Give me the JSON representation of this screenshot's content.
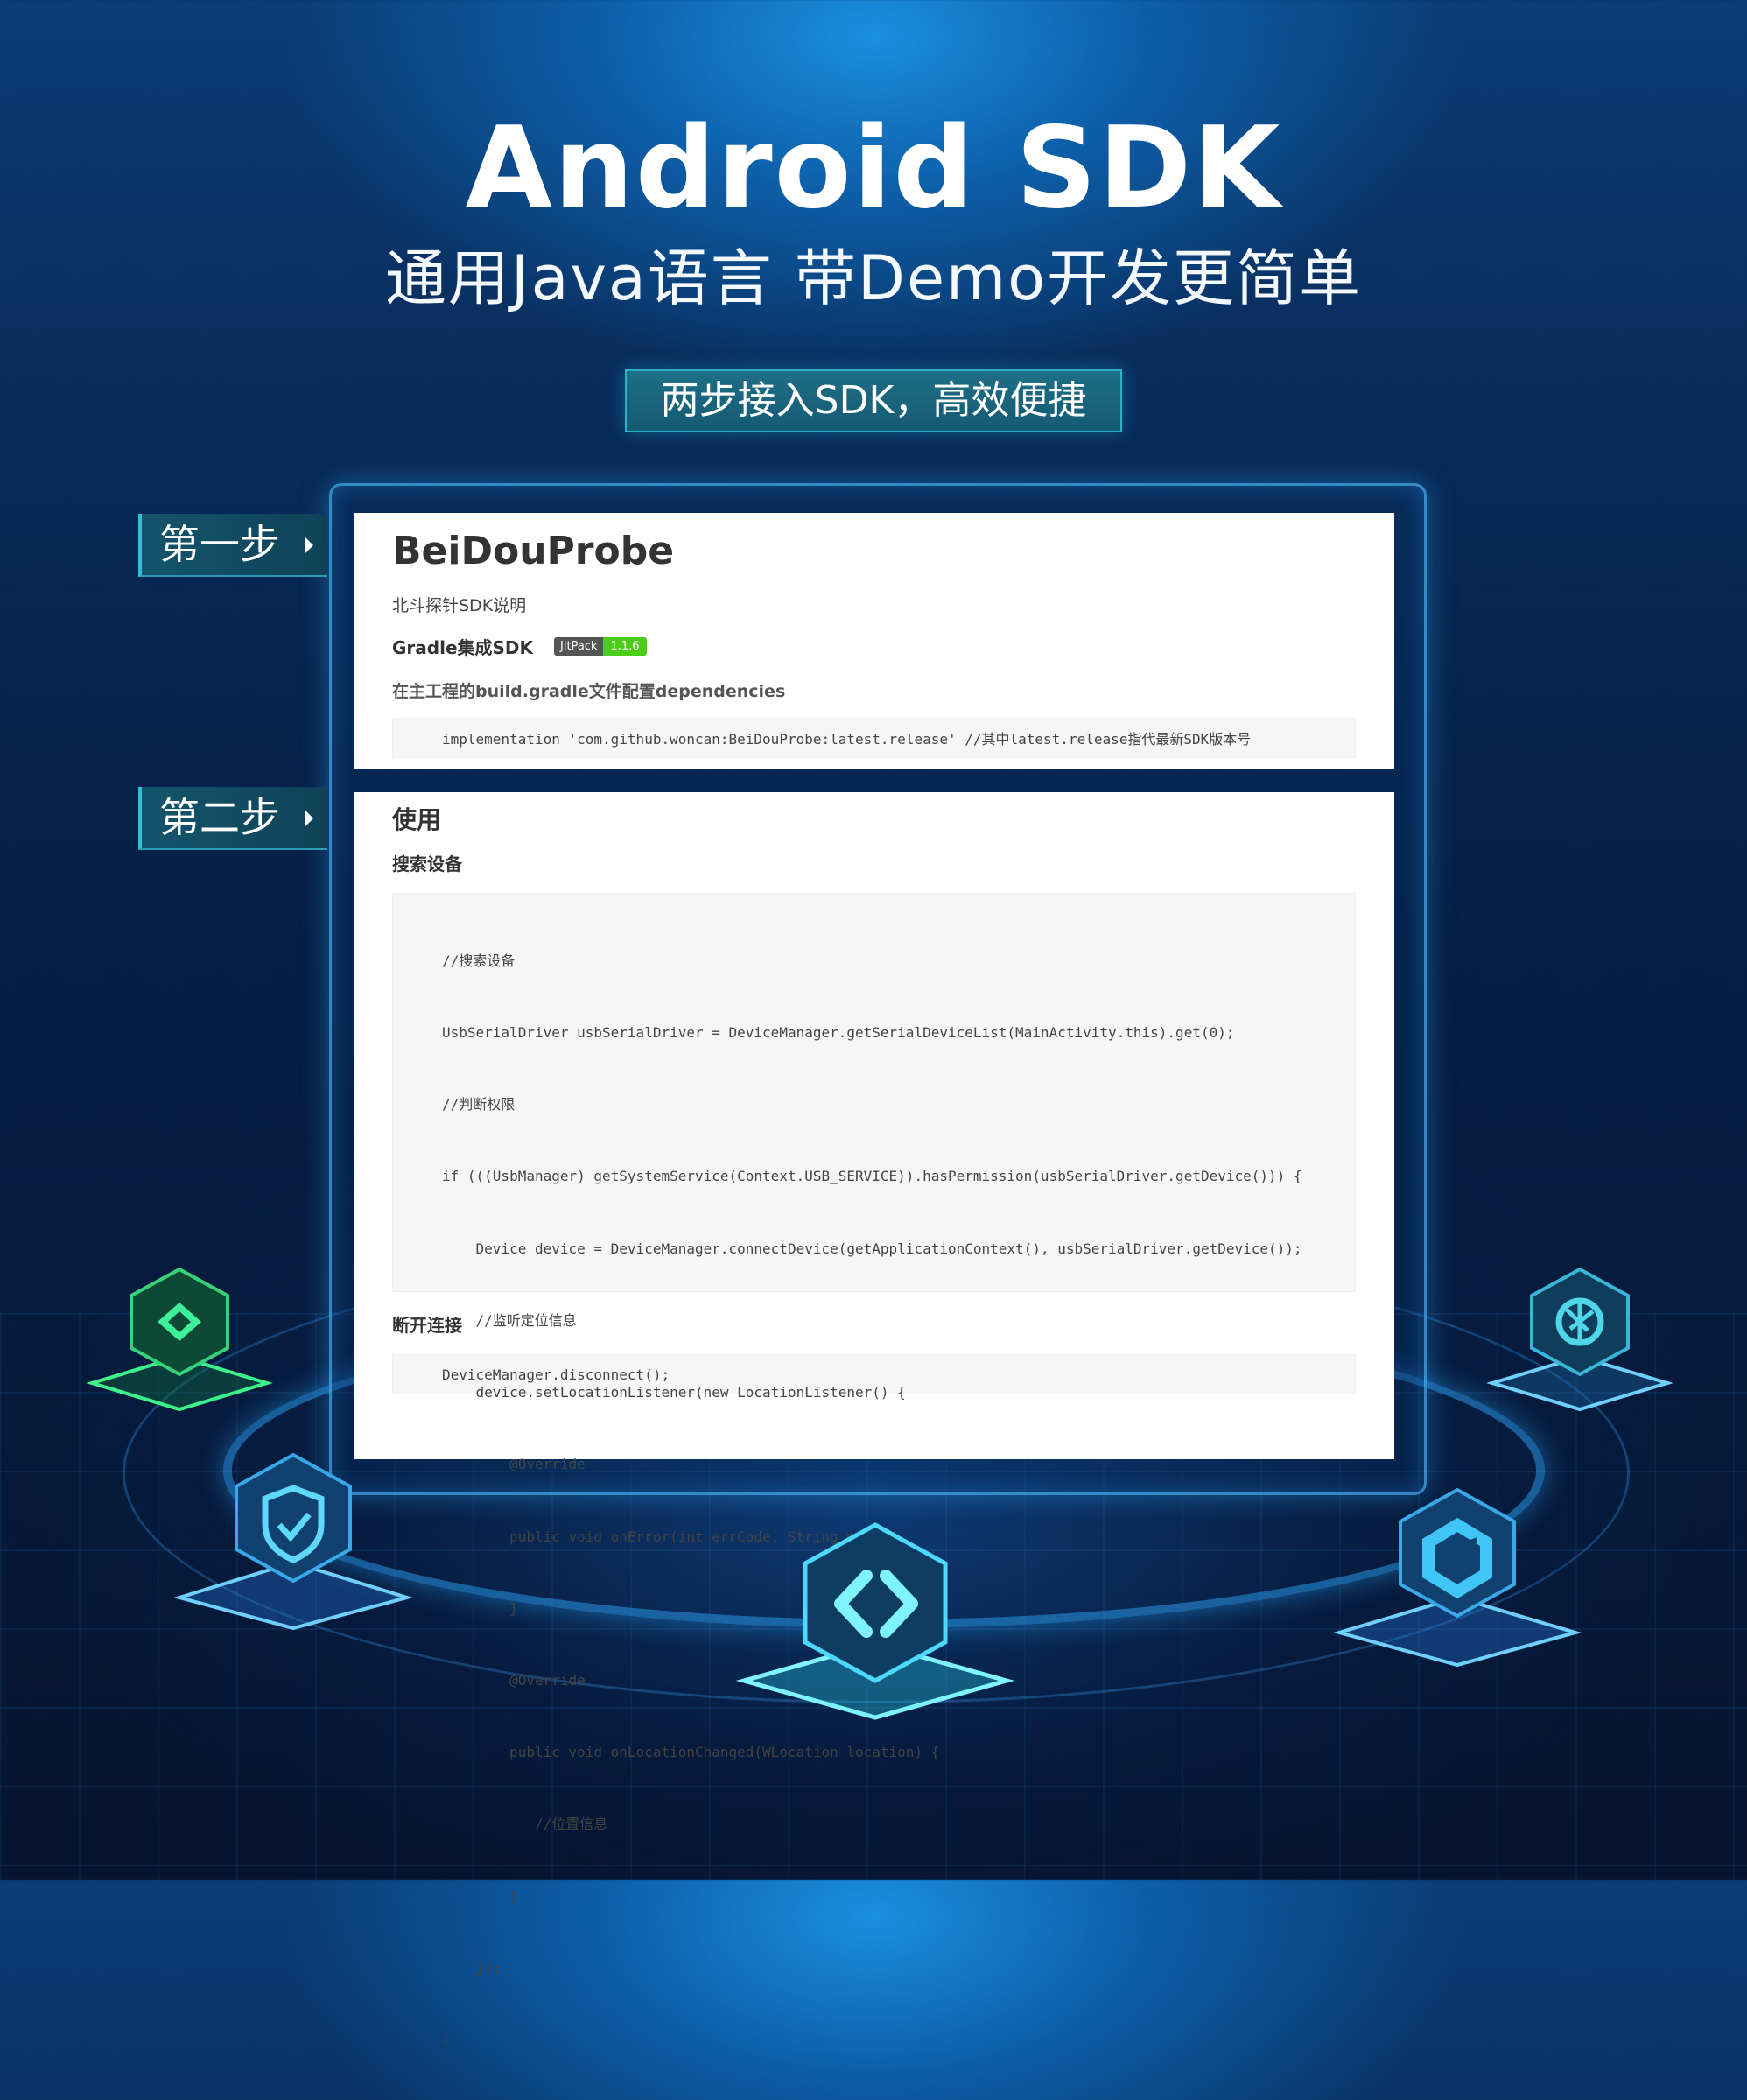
{
  "header": {
    "title": "Android SDK",
    "subtitle": "通用Java语言  带Demo开发更简单",
    "banner": "两步接入SDK，高效便捷"
  },
  "steps": [
    {
      "label": "第一步"
    },
    {
      "label": "第二步"
    }
  ],
  "doc": {
    "title": "BeiDouProbe",
    "description": "北斗探针SDK说明",
    "gradle_heading": "Gradle集成SDK",
    "badge_left": "JitPack",
    "badge_right": "1.1.6",
    "dependencies_note": "在主工程的build.gradle文件配置dependencies",
    "implementation_code": "implementation 'com.github.woncan:BeiDouProbe:latest.release' //其中latest.release指代最新SDK版本号",
    "usage_heading": "使用",
    "search_heading": "搜索设备",
    "search_code": [
      "//搜索设备",
      "UsbSerialDriver usbSerialDriver = DeviceManager.getSerialDeviceList(MainActivity.this).get(0);",
      "//判断权限",
      "if (((UsbManager) getSystemService(Context.USB_SERVICE)).hasPermission(usbSerialDriver.getDevice())) {",
      "    Device device = DeviceManager.connectDevice(getApplicationContext(), usbSerialDriver.getDevice());",
      "    //监听定位信息",
      "    device.setLocationListener(new LocationListener() {",
      "        @Override",
      "        public void onError(int errCode, String msg) {",
      "        }",
      "        @Override",
      "        public void onLocationChanged(WLocation location) {",
      "           //位置信息",
      "        }",
      "    });",
      "}"
    ],
    "disconnect_heading": "断开连接",
    "disconnect_code": "DeviceManager.disconnect();"
  },
  "colors": {
    "accent": "#2dc1d8",
    "badge_green": "#4ccd1a",
    "background_dark": "#061a3a"
  },
  "icons": [
    "diamond-icon",
    "shield-check-icon",
    "code-link-icon",
    "shutter-icon",
    "hexagon-logo-icon"
  ]
}
